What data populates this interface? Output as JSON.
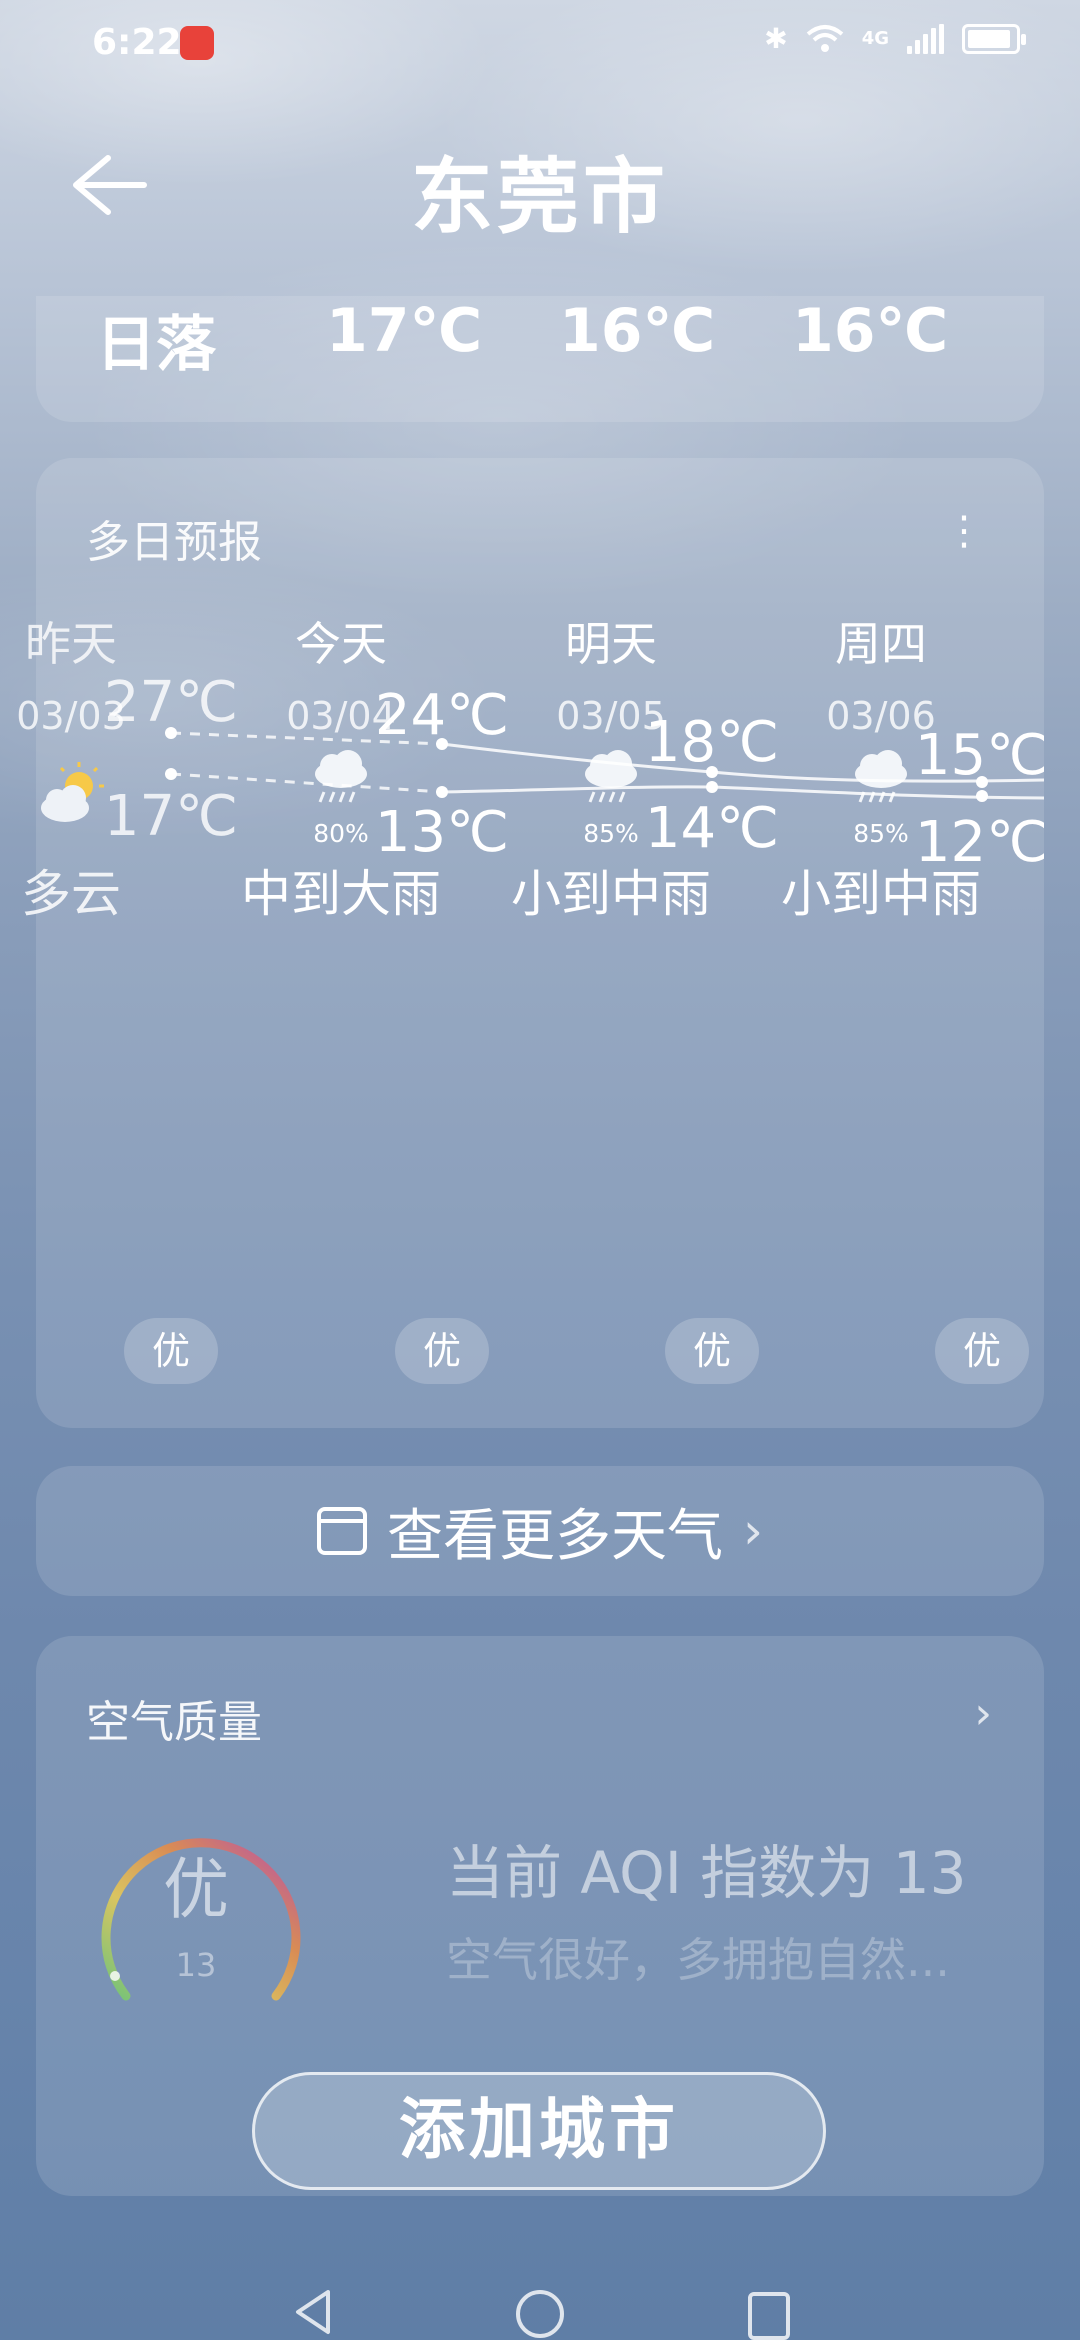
{
  "status_bar": {
    "time": "6:22",
    "network": "4G"
  },
  "header": {
    "city": "东莞市"
  },
  "top_row": {
    "label": "日落",
    "temps": [
      "17℃",
      "16℃",
      "16℃"
    ]
  },
  "forecast": {
    "title": "多日预报",
    "days": [
      {
        "day": "昨天",
        "date": "03/03",
        "icon": "partly-cloudy-icon",
        "rain_pct": "",
        "condition": "多云",
        "high": "27℃",
        "low": "17℃",
        "aqi": "优"
      },
      {
        "day": "今天",
        "date": "03/04",
        "icon": "rain-icon",
        "rain_pct": "80%",
        "condition": "中到大雨",
        "high": "24℃",
        "low": "13℃",
        "aqi": "优"
      },
      {
        "day": "明天",
        "date": "03/05",
        "icon": "rain-icon",
        "rain_pct": "85%",
        "condition": "小到中雨",
        "high": "18℃",
        "low": "14℃",
        "aqi": "优"
      },
      {
        "day": "周四",
        "date": "03/06",
        "icon": "rain-icon",
        "rain_pct": "85%",
        "condition": "小到中雨",
        "high": "15℃",
        "low": "12℃",
        "aqi": "优"
      }
    ]
  },
  "more_weather": {
    "label": "查看更多天气"
  },
  "air_quality": {
    "title": "空气质量",
    "level": "优",
    "value": "13",
    "aqi_text": "当前 AQI 指数为 13",
    "advice": "空气很好，多拥抱自然..."
  },
  "add_city": {
    "label": "添加城市"
  },
  "colors": {
    "background_top": "#cfd7e3",
    "background_bottom": "#5f7ea6"
  }
}
